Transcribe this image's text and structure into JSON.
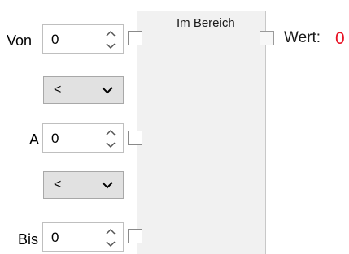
{
  "block": {
    "title": "Im Bereich"
  },
  "inputs": {
    "von": {
      "label": "Von",
      "value": "0"
    },
    "a": {
      "label": "A",
      "value": "0"
    },
    "bis": {
      "label": "Bis",
      "value": "0"
    }
  },
  "comparators": [
    {
      "value": "<"
    },
    {
      "value": "<"
    }
  ],
  "output": {
    "label": "Wert:",
    "value": "0",
    "value_color": "#e81123"
  },
  "icons": {
    "spin_up": "chevron-up-icon",
    "spin_down": "chevron-down-icon",
    "dropdown": "chevron-down-icon"
  }
}
